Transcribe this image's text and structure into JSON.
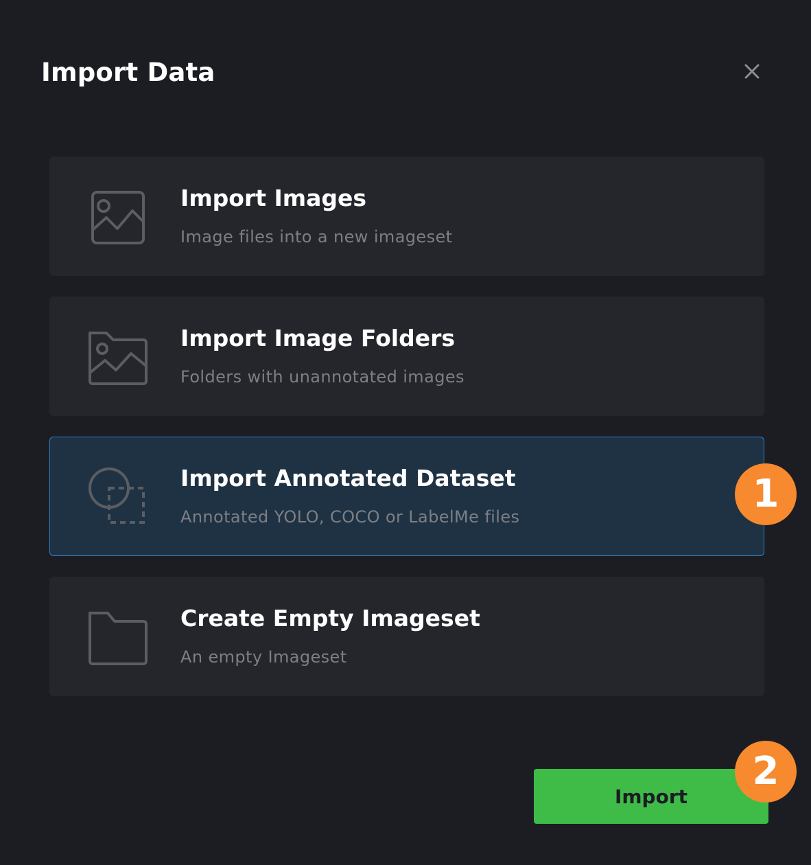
{
  "dialog": {
    "title": "Import Data",
    "close_label": "×"
  },
  "options": [
    {
      "title": "Import Images",
      "description": "Image files into a new imageset",
      "icon": "image-icon",
      "selected": false
    },
    {
      "title": "Import Image Folders",
      "description": "Folders with unannotated images",
      "icon": "image-folder-icon",
      "selected": false
    },
    {
      "title": "Import Annotated Dataset",
      "description": "Annotated YOLO, COCO or LabelMe files",
      "icon": "annotation-shapes-icon",
      "selected": true
    },
    {
      "title": "Create Empty Imageset",
      "description": "An empty Imageset",
      "icon": "folder-icon",
      "selected": false
    }
  ],
  "footer": {
    "import_label": "Import"
  },
  "step_badges": [
    "1",
    "2"
  ],
  "colors": {
    "background": "#1b1d22",
    "card": "#24262b",
    "card_selected": "#1f3243",
    "selected_border": "#2f7fc7",
    "primary_button": "#3fbc48",
    "badge": "#f7892f",
    "icon_stroke": "#5a5d63"
  }
}
